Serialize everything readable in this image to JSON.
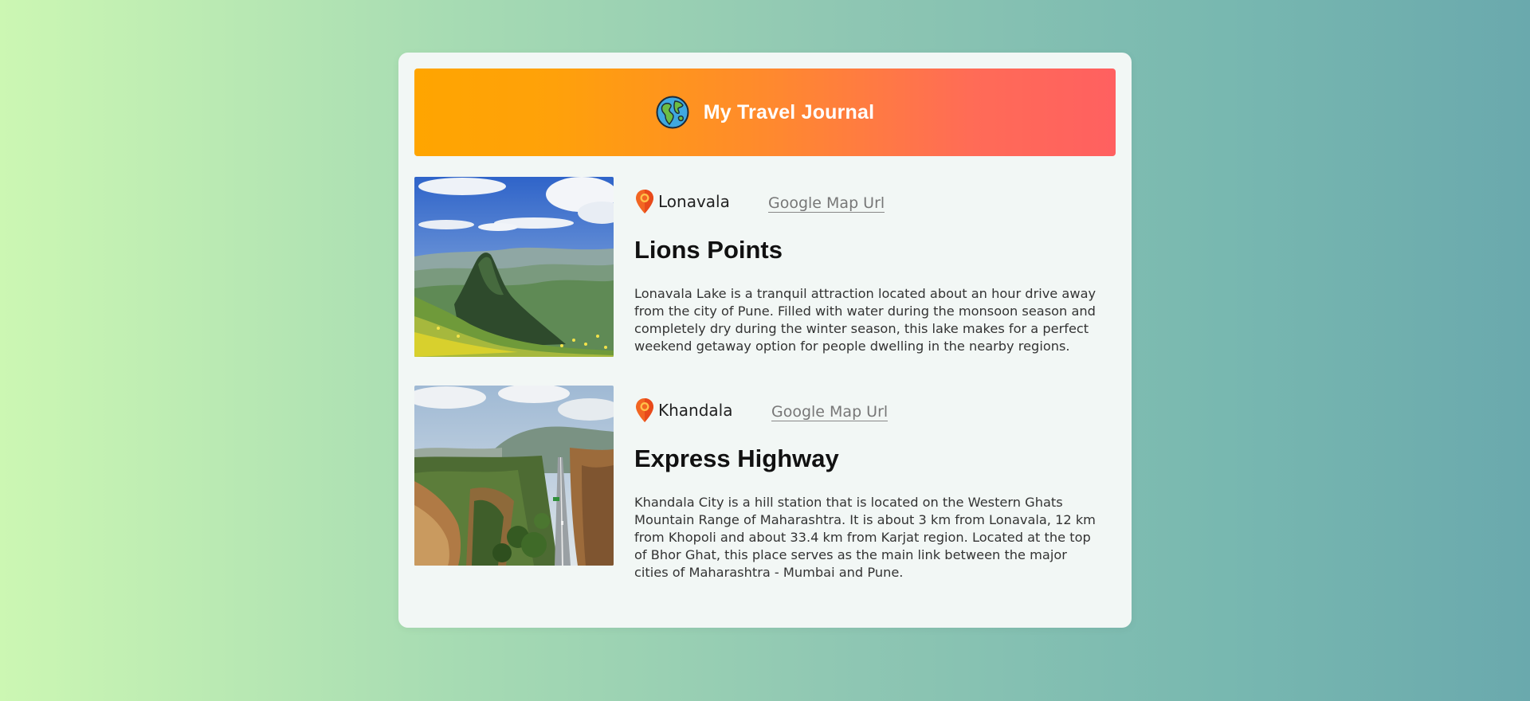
{
  "header": {
    "title": "My Travel Journal",
    "icon": "globe-icon"
  },
  "entries": [
    {
      "location": "Lonavala",
      "map_link_label": "Google Map Url",
      "title": "Lions Points",
      "description": "Lonavala Lake is a tranquil attraction located about an hour drive away from the city of Pune. Filled with water during the monsoon season and completely dry during the winter season, this lake makes for a perfect weekend getaway option for people dwelling in the nearby regions.",
      "image": "mountain-peak-photo"
    },
    {
      "location": "Khandala",
      "map_link_label": "Google Map Url",
      "title": "Express Highway",
      "description": "Khandala City is a hill station that is located on the Western Ghats Mountain Range of Maharashtra. It is about 3 km from Lonavala, 12 km from Khopoli and about 33.4 km from Karjat region. Located at the top of Bhor Ghat, this place serves as the main link between the major cities of Maharashtra - Mumbai and Pune.",
      "image": "valley-highway-photo"
    }
  ],
  "colors": {
    "header_gradient_start": "#ffa500",
    "header_gradient_end": "#ff6060",
    "card_background": "#f2f7f5",
    "page_gradient_start": "#ccf7b3",
    "page_gradient_end": "#6aa9ad",
    "pin": "#f26522"
  }
}
